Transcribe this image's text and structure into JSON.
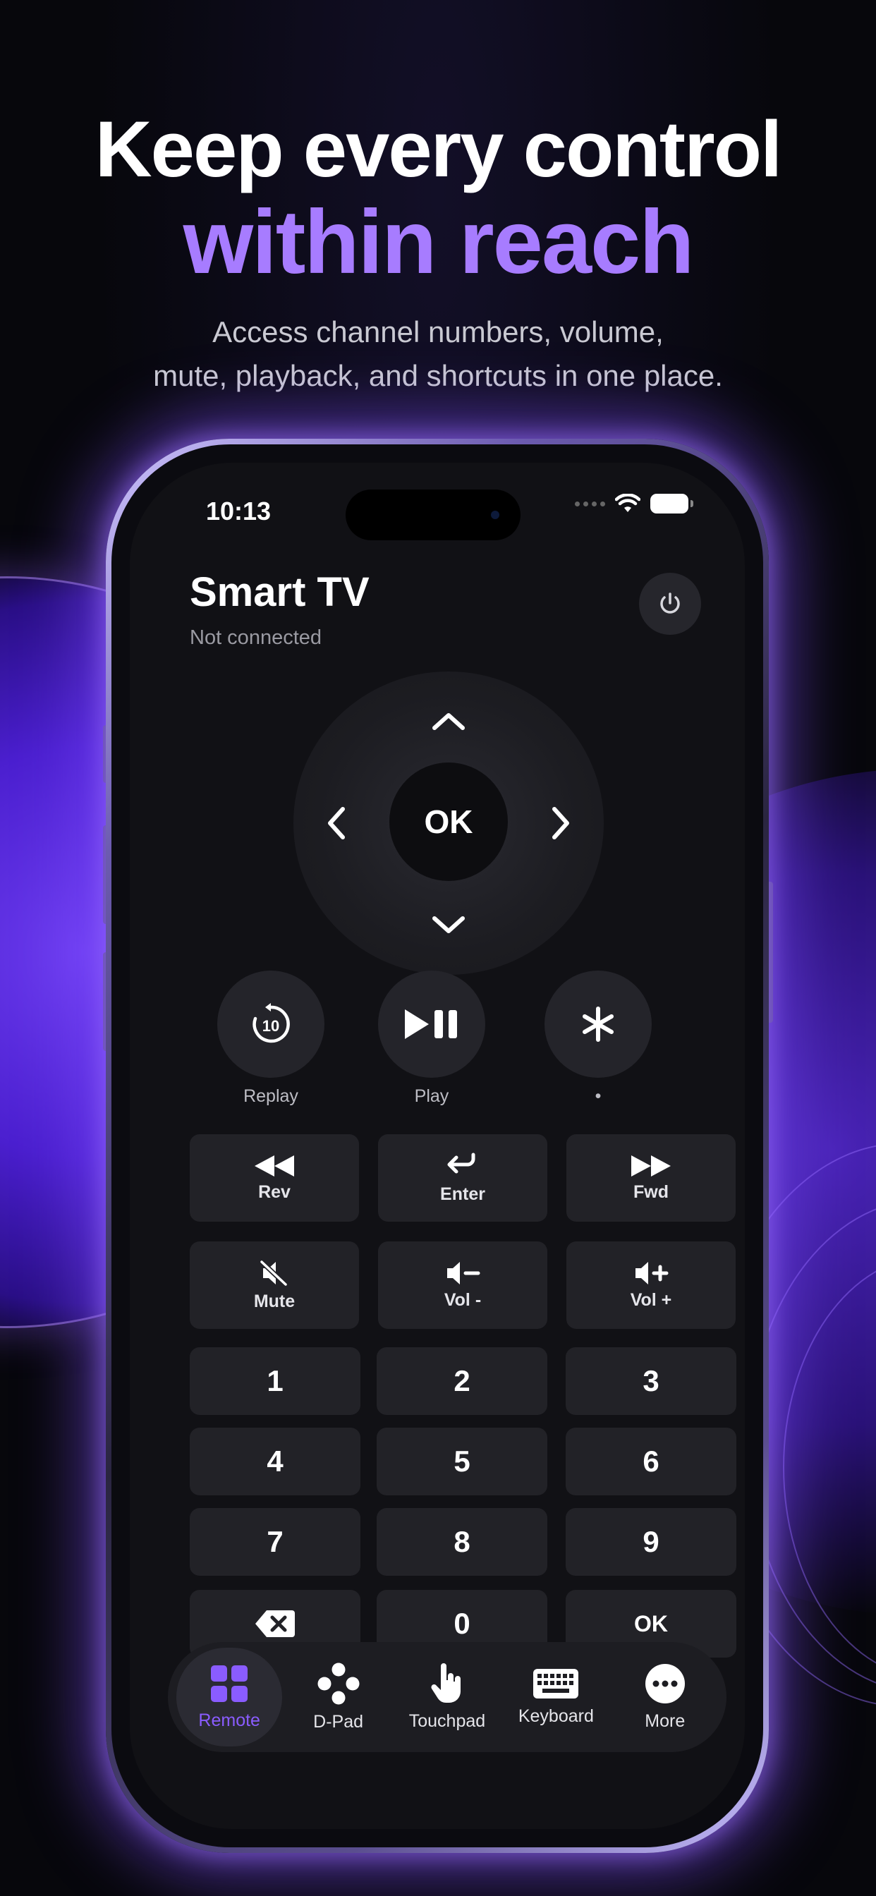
{
  "headline": {
    "line1": "Keep every control",
    "line2": "within reach",
    "subtitle_line1": "Access channel numbers, volume,",
    "subtitle_line2": "mute, playback, and shortcuts in one place."
  },
  "status_bar": {
    "time": "10:13"
  },
  "device": {
    "title": "Smart TV",
    "status": "Not connected"
  },
  "dpad": {
    "ok_label": "OK"
  },
  "media": [
    {
      "label": "Replay",
      "icon": "replay-10-icon",
      "badge": "10"
    },
    {
      "label": "Play",
      "icon": "play-pause-icon"
    },
    {
      "label": "•",
      "icon": "asterisk-icon"
    }
  ],
  "control_keys": [
    {
      "label": "Rev",
      "icon": "rewind-icon"
    },
    {
      "label": "Enter",
      "icon": "enter-return-icon"
    },
    {
      "label": "Fwd",
      "icon": "fast-forward-icon"
    },
    {
      "label": "Mute",
      "icon": "mute-icon"
    },
    {
      "label": "Vol -",
      "icon": "volume-down-icon"
    },
    {
      "label": "Vol +",
      "icon": "volume-up-icon"
    }
  ],
  "numpad": [
    "1",
    "2",
    "3",
    "4",
    "5",
    "6",
    "7",
    "8",
    "9",
    "",
    "0",
    "OK"
  ],
  "tabs": [
    {
      "label": "Remote",
      "icon": "grid-icon",
      "active": true
    },
    {
      "label": "D-Pad",
      "icon": "dpad-icon"
    },
    {
      "label": "Touchpad",
      "icon": "hand-pointer-icon"
    },
    {
      "label": "Keyboard",
      "icon": "keyboard-icon"
    },
    {
      "label": "More",
      "icon": "more-icon"
    }
  ],
  "colors": {
    "accent": "#a77cff",
    "tab_active": "#8a5cff",
    "background": "#07070c",
    "key": "#222227"
  }
}
